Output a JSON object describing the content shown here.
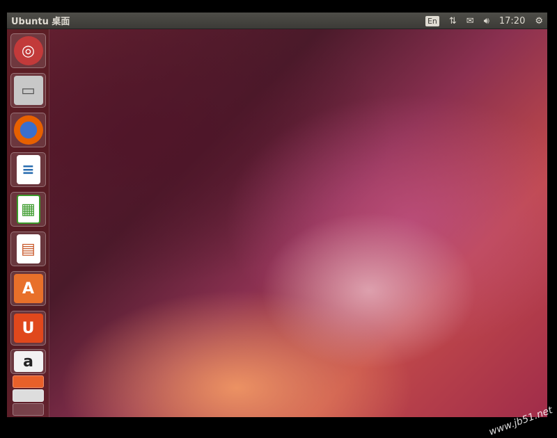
{
  "topbar": {
    "title": "Ubuntu 桌面",
    "keyboard": "En",
    "time": "17:20"
  },
  "launcher": {
    "items": [
      {
        "name": "dash-home",
        "icon": "ubuntu-logo-icon",
        "color": "#c23a3a"
      },
      {
        "name": "files",
        "icon": "file-cabinet-icon",
        "color": "#bbb"
      },
      {
        "name": "firefox",
        "icon": "firefox-icon",
        "color": "#e66000"
      },
      {
        "name": "libreoffice-writer",
        "icon": "writer-icon",
        "color": "#2a6db0"
      },
      {
        "name": "libreoffice-calc",
        "icon": "calc-icon",
        "color": "#3a9a2a"
      },
      {
        "name": "libreoffice-impress",
        "icon": "impress-icon",
        "color": "#c8582a"
      },
      {
        "name": "ubuntu-software-center",
        "icon": "software-center-icon",
        "color": "#e8702a"
      },
      {
        "name": "ubuntu-one",
        "icon": "ubuntu-one-icon",
        "color": "#e0481c"
      },
      {
        "name": "amazon",
        "icon": "amazon-icon",
        "color": "#f2f2f2"
      }
    ]
  },
  "watermark": "www.jb51.net"
}
